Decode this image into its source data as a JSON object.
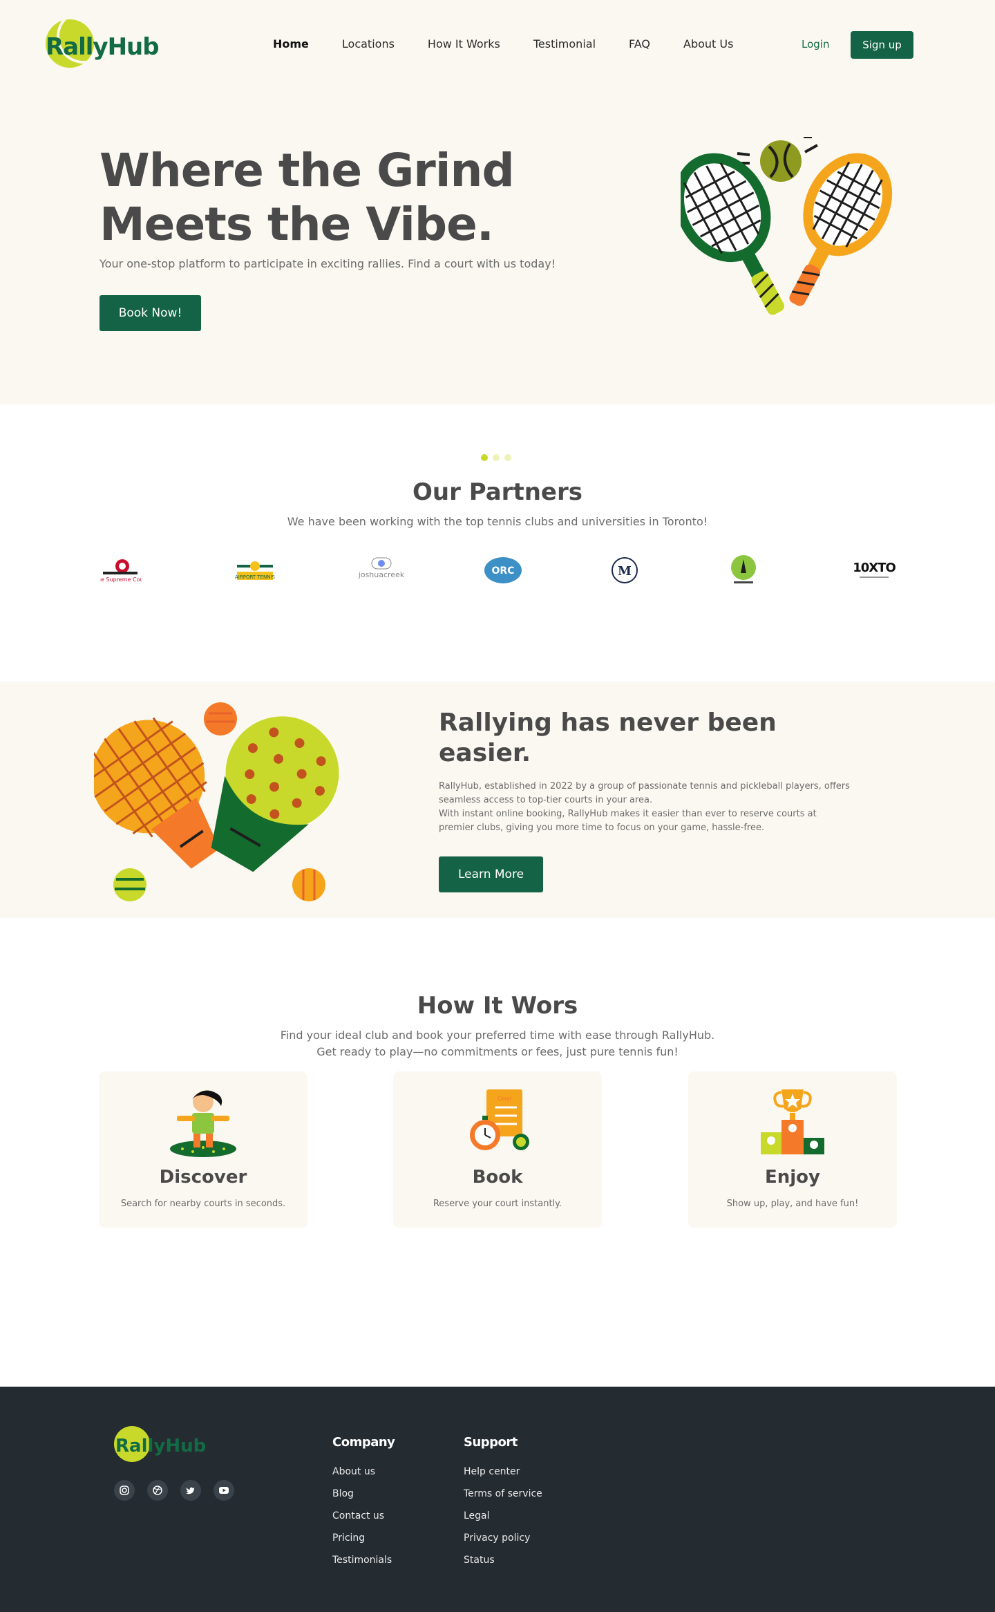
{
  "brand": {
    "name": "RallyHub",
    "primary": "#146346",
    "accent": "#c8d92b",
    "cream": "#fbf8f1",
    "footer_bg": "#242b31"
  },
  "nav": {
    "links": [
      {
        "label": "Home",
        "active": true
      },
      {
        "label": "Locations"
      },
      {
        "label": "How It Works"
      },
      {
        "label": "Testimonial"
      },
      {
        "label": "FAQ"
      },
      {
        "label": "About Us"
      }
    ],
    "login": "Login",
    "signup": "Sign up"
  },
  "hero": {
    "title_line1": "Where the Grind",
    "title_line2": "Meets the Vibe.",
    "subtitle": "Your one-stop platform to participate in exciting rallies. Find a court with us today!",
    "cta": "Book Now!",
    "illustration": "tennis-rackets-icon"
  },
  "partners": {
    "carousel_active": 1,
    "title": "Our Partners",
    "subtitle": "We have been working with the top tennis clubs and universities in Toronto!",
    "logos": [
      {
        "name": "supreme-court-logo",
        "text": "The Supreme Court"
      },
      {
        "name": "airport-tennis-logo",
        "text": "AIRPORT TENNIS"
      },
      {
        "name": "joshuacreek-logo",
        "text": "joshuacreek"
      },
      {
        "name": "orc-logo",
        "text": "ORC"
      },
      {
        "name": "m-logo",
        "text": "M"
      },
      {
        "name": "club-logo",
        "text": ""
      },
      {
        "name": "10xto-logo",
        "text": "10XTO"
      }
    ]
  },
  "easier": {
    "title": "Rallying has never been easier.",
    "p1": "RallyHub, established in 2022 by a group of passionate tennis and pickleball players, offers seamless access to top-tier courts in your area.",
    "p2": "With instant online booking, RallyHub makes it easier than ever to reserve courts at premier clubs, giving you more time to focus on your game, hassle-free.",
    "cta": "Learn More"
  },
  "how": {
    "title": "How It Wors",
    "sub1": "Find your ideal club and book your preferred time with ease through RallyHub.",
    "sub2": "Get ready to play—no commitments or fees, just pure tennis fun!",
    "cards": [
      {
        "title": "Discover",
        "text": "Search for nearby courts in seconds.",
        "icon": "player-icon"
      },
      {
        "title": "Book",
        "text": "Reserve your court instantly.",
        "icon": "stopwatch-goal-icon"
      },
      {
        "title": "Enjoy",
        "text": "Show up, play, and have fun!",
        "icon": "trophy-podium-icon"
      }
    ]
  },
  "footer": {
    "brand": "RallyHub",
    "socials": [
      "instagram-icon",
      "dribbble-icon",
      "twitter-icon",
      "youtube-icon"
    ],
    "company": {
      "title": "Company",
      "links": [
        "About us",
        "Blog",
        "Contact us",
        "Pricing",
        "Testimonials"
      ]
    },
    "support": {
      "title": "Support",
      "links": [
        "Help center",
        "Terms of service",
        "Legal",
        "Privacy policy",
        "Status"
      ]
    }
  }
}
